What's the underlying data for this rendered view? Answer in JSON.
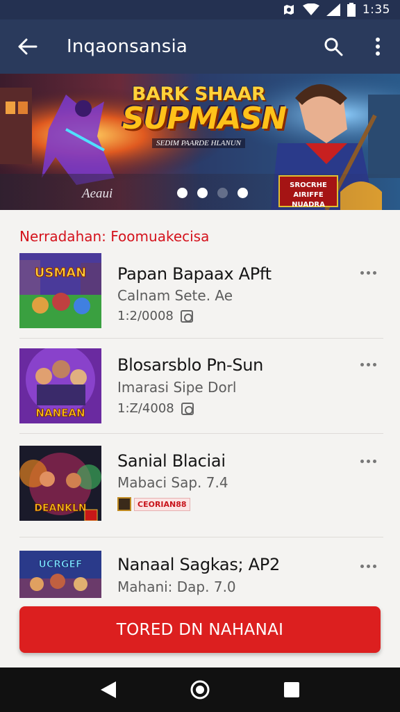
{
  "status_bar": {
    "time": "1:35"
  },
  "app_bar": {
    "title": "Inqaonsansia",
    "icons": [
      "arrow-left-icon",
      "search-icon",
      "more-vertical-icon"
    ]
  },
  "banner": {
    "title_line1": "BARK SHAAR",
    "title_line2": "SUPMASN",
    "title_sub": "SEDIM PAARDE HLANUN",
    "caption": "Aeaui",
    "page_indicator": {
      "pages": 4,
      "active": [
        1,
        2,
        4
      ]
    },
    "badge": "SROCRHE AIRIFFE NUADRA"
  },
  "section": {
    "title": "Nerradahan: Foomuakecisa"
  },
  "items": [
    {
      "name": "Papan Bapaax APft",
      "subtitle": "Calnam Sete. Ae",
      "meta": "1:2/0008",
      "thumb_text": "USMAN"
    },
    {
      "name": "Blosarsblo Pn-Sun",
      "subtitle": "Imarasi Sipe Dorl",
      "meta": "1:Z/4008",
      "thumb_text": "NANEAN"
    },
    {
      "name": "Sanial Blaciai",
      "subtitle": "Mabaci Sap. 7.4",
      "meta": "",
      "tag": "CEORIAN88",
      "thumb_text": "DEANKLN"
    },
    {
      "name": "Nanaal Sagkas; AP2",
      "subtitle": "Mahani: Dap. 7.0",
      "meta": "",
      "thumb_text": "UCRGEF"
    }
  ],
  "cta": {
    "label": "TORED DN NAHANAI"
  },
  "colors": {
    "accent": "#dc1f1f",
    "app_bar": "#2a3a5c",
    "status_bar": "#243151",
    "section_title": "#d4121c"
  }
}
